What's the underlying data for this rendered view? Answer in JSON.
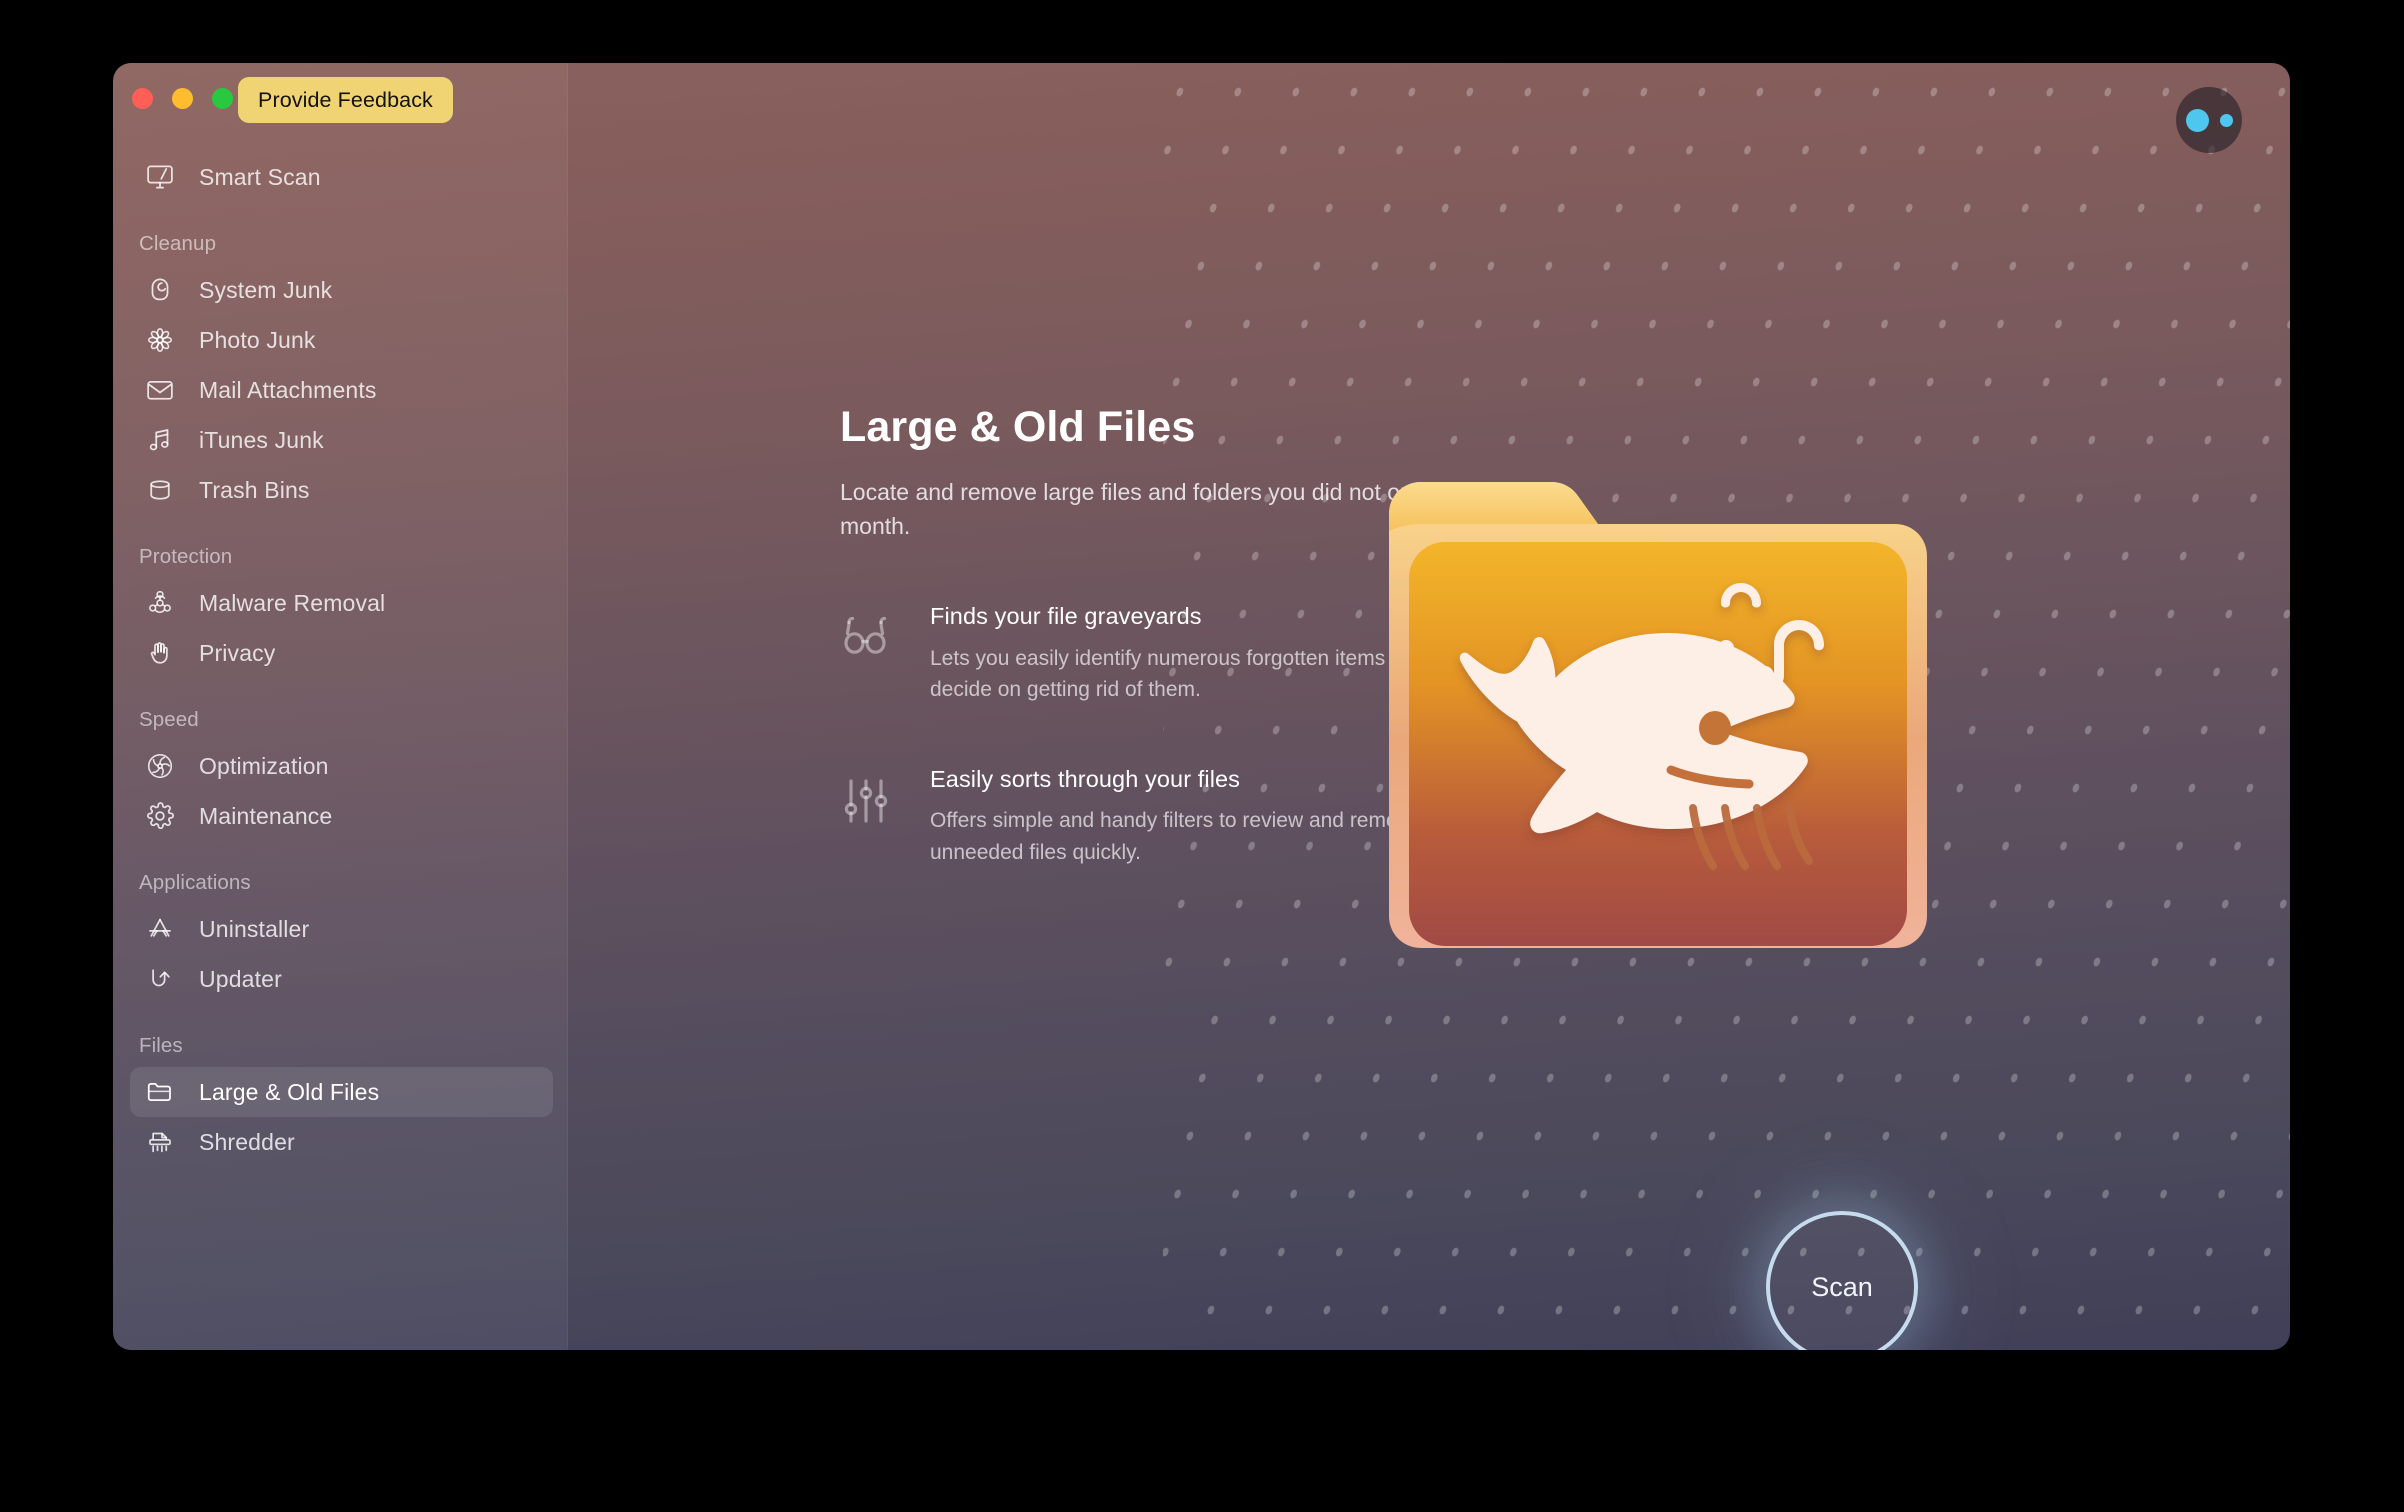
{
  "window": {
    "traffic_lights": [
      "close",
      "minimize",
      "zoom"
    ],
    "feedback_button": "Provide Feedback"
  },
  "sidebar": {
    "groups": [
      {
        "label": null,
        "items": [
          {
            "label": "Smart Scan",
            "icon": "display-icon",
            "selected": false
          }
        ]
      },
      {
        "label": "Cleanup",
        "items": [
          {
            "label": "System Junk",
            "icon": "system-junk-icon",
            "selected": false
          },
          {
            "label": "Photo Junk",
            "icon": "flower-icon",
            "selected": false
          },
          {
            "label": "Mail Attachments",
            "icon": "envelope-icon",
            "selected": false
          },
          {
            "label": "iTunes Junk",
            "icon": "music-note-icon",
            "selected": false
          },
          {
            "label": "Trash Bins",
            "icon": "trash-bin-icon",
            "selected": false
          }
        ]
      },
      {
        "label": "Protection",
        "items": [
          {
            "label": "Malware Removal",
            "icon": "biohazard-icon",
            "selected": false
          },
          {
            "label": "Privacy",
            "icon": "hand-icon",
            "selected": false
          }
        ]
      },
      {
        "label": "Speed",
        "items": [
          {
            "label": "Optimization",
            "icon": "fan-icon",
            "selected": false
          },
          {
            "label": "Maintenance",
            "icon": "gear-icon",
            "selected": false
          }
        ]
      },
      {
        "label": "Applications",
        "items": [
          {
            "label": "Uninstaller",
            "icon": "app-store-icon",
            "selected": false
          },
          {
            "label": "Updater",
            "icon": "update-arrow-icon",
            "selected": false
          }
        ]
      },
      {
        "label": "Files",
        "items": [
          {
            "label": "Large & Old Files",
            "icon": "folder-icon",
            "selected": true
          },
          {
            "label": "Shredder",
            "icon": "shredder-icon",
            "selected": false
          }
        ]
      }
    ]
  },
  "main": {
    "title": "Large & Old Files",
    "subtitle": "Locate and remove large files and folders you did not open for month.",
    "features": [
      {
        "icon": "glasses-icon",
        "title": "Finds your file graveyards",
        "description": "Lets you easily identify numerous forgotten items to decide on getting rid of them."
      },
      {
        "icon": "sliders-icon",
        "title": "Easily sorts through your files",
        "description": "Offers simple and handy filters to review and remove unneeded files quickly."
      }
    ],
    "hero_icon": "whale-folder-icon",
    "scan_button": "Scan",
    "status_badge": "connection-status-badge"
  },
  "colors": {
    "feedback_accent": "#f0d474",
    "badge_dot": "#4ec7f0",
    "scan_ring": "#c6dcee",
    "folder_top": "#f5c65e",
    "folder_bottom": "#a8504a",
    "window_top": "#8a615d",
    "window_bottom": "#413f58"
  }
}
